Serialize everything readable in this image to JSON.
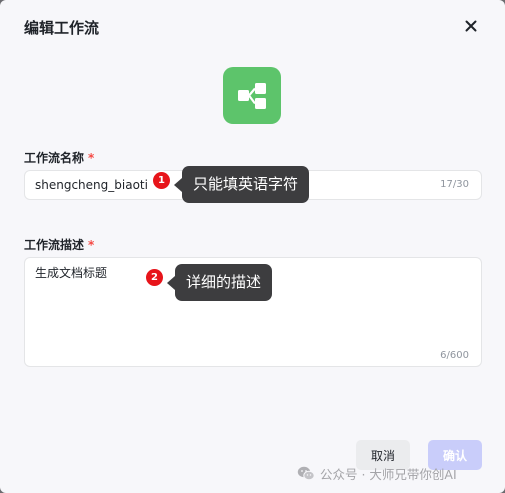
{
  "dialog": {
    "title": "编辑工作流",
    "close_icon": "close-icon",
    "app_icon": "workflow-share-icon",
    "accent_color": "#5dc46b"
  },
  "name_field": {
    "label": "工作流名称",
    "required_mark": "*",
    "value": "shengcheng_biaoti",
    "counter": "17/30"
  },
  "desc_field": {
    "label": "工作流描述",
    "required_mark": "*",
    "value": "生成文档标题",
    "counter": "6/600"
  },
  "annotations": [
    {
      "number": "1",
      "text": "只能填英语字符"
    },
    {
      "number": "2",
      "text": "详细的描述"
    }
  ],
  "footer": {
    "cancel_label": "取消",
    "confirm_label": "确认"
  },
  "watermark": {
    "text": "公众号 · 大师兄带你创AI",
    "icon": "wechat-icon"
  }
}
